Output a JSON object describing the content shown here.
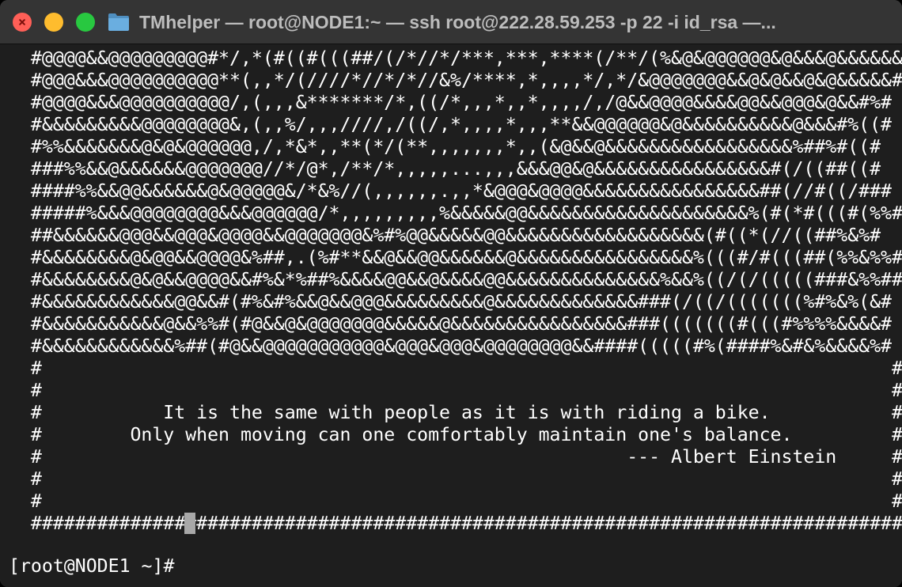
{
  "window": {
    "title": "TMhelper — root@NODE1:~ — ssh root@222.28.59.253 -p 22 -i id_rsa —..."
  },
  "colors": {
    "background": "#1e1e1e",
    "titlebar": "#343434",
    "text": "#ffffff",
    "close": "#ff5f57",
    "minimize": "#febc2e",
    "maximize": "#28c840",
    "cursor": "#a8a8a8"
  },
  "icons": [
    "close-icon",
    "minimize-icon",
    "maximize-icon",
    "folder-icon"
  ],
  "terminal": {
    "lines": [
      "  #@@@@&&@@@@@@@@@#*/,*(#((#(((##/(/*//*/***,***,****(/**/(%&@&@@@@@@&@&&&@&&&&&&#",
      "  #@@@&&&@@@@@@@@@@**(,,*/(////*//*/*//&%/****,*,,,,*/,*/&@@@@@@@&&@&@&&@&@&&&&&#",
      "  #@@@@&&&@@@@@@@@@@/,(,,,&*******/*,((/*,,,*,,*,,,,/,/@&&@@@@&&&&@@&&@@@&@&&#%#",
      "  #&&&&&&&&&@@@@@@@@&,(,,%/,,,////,/((/,*,,,,*,,,**&&@@@@@@&@&&&&&&&&&&@&&&#%((#",
      "  #%%&&&&&&&@&@&@@@@@@,/,*&*,,**(*/(**,,,,,,,*,,(&@&&@&&&&&&&&&&&&&&&&&%##%#((#",
      "  ###%%&&@&&&&&&@@@@@@@//*/@*,/**/*,,,,,...,,,&&&@@&@&&&&&&&&&&&&&&&&#(/((##((#",
      "  ####%%&&@@&&&&&&@&@@@@@&/*&%//(,,,,,,.,,*&@@@&@@@@&&&&&&&&&&&&&&&&##(//#((/###",
      "  #####%&&&@@@@@@@@&&&@@@@@@/*,,,,,,,,,%&&&&&@@&&&&&&&&&&&&&&&&&&&&%(#(*#(((#(%%#",
      "  ##&&&&&&@@@&&@@@&@@@@&&@@@@@@@&%#%@@&&&&&@@&&&&&&&&&&&&&&&&&&(#((*(//((##%&%#",
      "  #&&&&&&&&@&@@&&@@@@&%##,.(%#**&&@&&@@&&&&&&@&&&&&&&&&&&&&&&&%(((#/#(((##(%%&%%#",
      "  #&&&&&&&&@&@&&@@@@&&#%&*%##%&&&&@@&&@&&&&@@&&&&&&&&&&&&&&%&&%((/(/(((((###&%%##",
      "  #&&&&&&&&&&&&@@&&#(#%&#%&&@&&@@@&&&&&&&&&@&&&&&&&&&&&&&###(/((/(((((((%#%&%(&#",
      "  #&&&&&&&&&&&@&&%%#(#@&&@&@@@@@@@&&&&&@&&&&&&&&&&&&&&&&###(((((((#(((#%%%%&&&&#",
      "  #&&&&&&&&&&&&%##(#@&&@@@@@@@@@@@&@@@&@@@&@@@@@@@@&&####(((((#%(####%&#&%&&&&%#",
      "  #                                                                             #",
      "  #                                                                             #",
      "  #           It is the same with people as it is with riding a bike.           #",
      "  #        Only when moving can one comfortably maintain one's balance.         #",
      "  #                                                     --- Albert Einstein     #",
      "  #                                                                             #",
      "  #                                                                             #",
      "  ###############################################################################"
    ],
    "prompt": "[root@NODE1 ~]# "
  }
}
